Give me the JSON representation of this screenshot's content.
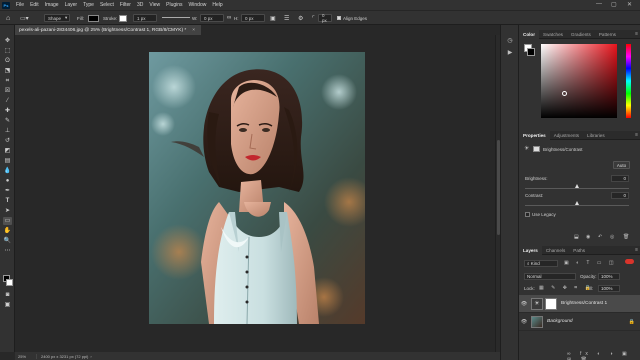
{
  "menubar": {
    "app_icon": "Ps",
    "items": [
      "File",
      "Edit",
      "Image",
      "Layer",
      "Type",
      "Select",
      "Filter",
      "3D",
      "View",
      "Plugins",
      "Window",
      "Help"
    ],
    "window_controls": [
      "—",
      "▢",
      "✕"
    ]
  },
  "options": {
    "tool_mode": "Shape",
    "fill_label": "Fill:",
    "stroke_label": "Stroke:",
    "stroke_width": "1 px",
    "w_label": "W:",
    "w_value": "0 px",
    "h_label": "H:",
    "h_value": "0 px",
    "radius_value": "0 px",
    "align_edges": "Align Edges"
  },
  "document": {
    "tab_title": "pexels-ali-pazani-2834406.jpg @ 25% (Brightness/Contrast 1, RGB/8/CMYK) *",
    "close": "×"
  },
  "status": {
    "zoom": "25%",
    "info": "2400 px x 3231 px (72 ppi)"
  },
  "color_panel": {
    "tabs": [
      "Color",
      "Swatches",
      "Gradients",
      "Patterns"
    ],
    "active_tab": "Color",
    "menu_icon": "≡"
  },
  "properties_panel": {
    "tabs": [
      "Properties",
      "Adjustments",
      "Libraries"
    ],
    "active_tab": "Properties",
    "title": "Brightness/Contrast",
    "auto_label": "Auto",
    "brightness_label": "Brightness:",
    "brightness_value": "0",
    "brightness_level": 0.5,
    "contrast_label": "Contrast:",
    "contrast_value": "0",
    "contrast_level": 0.5,
    "use_legacy_label": "Use Legacy",
    "menu_icon": "≡"
  },
  "layers_panel": {
    "tabs": [
      "Layers",
      "Channels",
      "Paths"
    ],
    "active_tab": "Layers",
    "filter_kind": "Kind",
    "blend_mode": "Normal",
    "opacity_label": "Opacity:",
    "opacity_value": "100%",
    "lock_label": "Lock:",
    "fill_label": "Fill:",
    "fill_value": "100%",
    "layers": [
      {
        "name": "Brightness/Contrast 1",
        "selected": true
      },
      {
        "name": "Background",
        "selected": false
      }
    ],
    "menu_icon": "≡"
  }
}
